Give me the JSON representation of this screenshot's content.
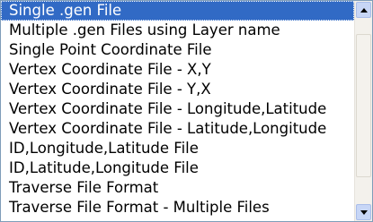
{
  "listbox": {
    "items": [
      "Single .gen File",
      "Multiple .gen Files using Layer name",
      "Single Point Coordinate File",
      "Vertex Coordinate File - X,Y",
      "Vertex Coordinate File - Y,X",
      "Vertex Coordinate File - Longitude,Latitude",
      "Vertex Coordinate File - Latitude,Longitude",
      "ID,Longitude,Latitude File",
      "ID,Latitude,Longitude File",
      "Traverse File Format",
      "Traverse File Format - Multiple Files"
    ],
    "selected_index": 0
  },
  "scrollbar": {
    "up_icon": "scroll-up-arrow",
    "down_icon": "scroll-down-arrow"
  },
  "colors": {
    "selection": "#316ac5",
    "border": "#7f9db9"
  }
}
